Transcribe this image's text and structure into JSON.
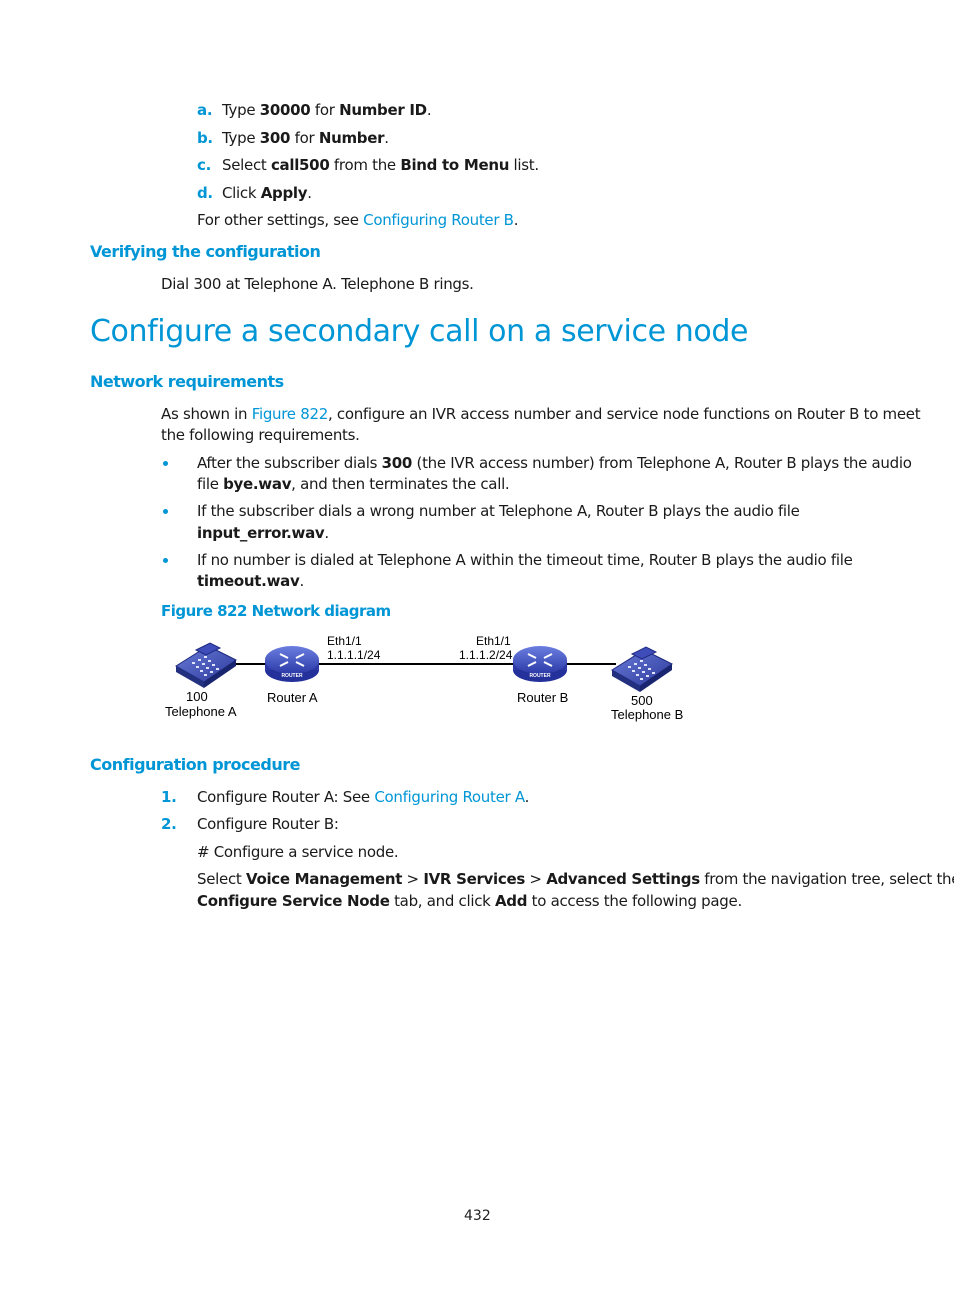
{
  "steps_top": [
    {
      "label": "a.",
      "parts": [
        "Type ",
        "30000",
        " for ",
        "Number ID",
        "."
      ]
    },
    {
      "label": "b.",
      "parts": [
        "Type ",
        "300",
        " for ",
        "Number",
        "."
      ]
    },
    {
      "label": "c.",
      "parts": [
        "Select ",
        "call500",
        " from the ",
        "Bind to Menu",
        " list."
      ]
    },
    {
      "label": "d.",
      "parts": [
        "Click ",
        "Apply",
        "."
      ]
    }
  ],
  "other_settings": {
    "prefix": "For other settings, see ",
    "link": "Configuring Router B",
    "suffix": "."
  },
  "verifying": {
    "heading": "Verifying the configuration",
    "text": "Dial 300 at Telephone A. Telephone B rings."
  },
  "section_title": "Configure a secondary call on a service node",
  "network_requirements": {
    "heading": "Network requirements",
    "intro_prefix": "As shown in ",
    "intro_link": "Figure 822",
    "intro_suffix": ", configure an IVR access number and service node functions on Router B to meet",
    "intro_line2": "the following requirements.",
    "bullets": [
      {
        "line1_a": "After the subscriber dials ",
        "line1_b": "300",
        "line1_c": " (the IVR access number) from Telephone A, Router B plays the audio",
        "line2_a": "file ",
        "line2_b": "bye.wav",
        "line2_c": ", and then terminates the call."
      },
      {
        "line1_a": "If the subscriber dials a wrong number at Telephone A, Router B plays the audio file",
        "line2_b": "input_error.wav",
        "line2_c": "."
      },
      {
        "line1_a": "If no number is dialed at Telephone A within the timeout time, Router B plays the audio file",
        "line2_b": "timeout.wav",
        "line2_c": "."
      }
    ]
  },
  "figure": {
    "caption": "Figure 822 Network diagram",
    "telephone_a": {
      "number": "100",
      "name": "Telephone A"
    },
    "router_a": {
      "name": "Router A",
      "iface": "Eth1/1",
      "ip": "1.1.1.1/24",
      "badge": "ROUTER"
    },
    "router_b": {
      "name": "Router B",
      "iface": "Eth1/1",
      "ip": "1.1.1.2/24",
      "badge": "ROUTER"
    },
    "telephone_b": {
      "number": "500",
      "name": "Telephone B"
    }
  },
  "procedure": {
    "heading": "Configuration procedure",
    "steps": [
      {
        "label": "1.",
        "prefix": "Configure Router A: See ",
        "link": "Configuring Router A",
        "suffix": "."
      },
      {
        "label": "2.",
        "text": "Configure Router B:"
      }
    ],
    "comment": "# Configure a service node.",
    "select_line1": [
      "Select ",
      "Voice Management",
      " > ",
      "IVR Services",
      " > ",
      "Advanced Settings",
      " from the navigation tree, select the"
    ],
    "select_line2": [
      "Configure Service Node",
      " tab, and click ",
      "Add",
      " to access the following page."
    ]
  },
  "page_number": "432"
}
